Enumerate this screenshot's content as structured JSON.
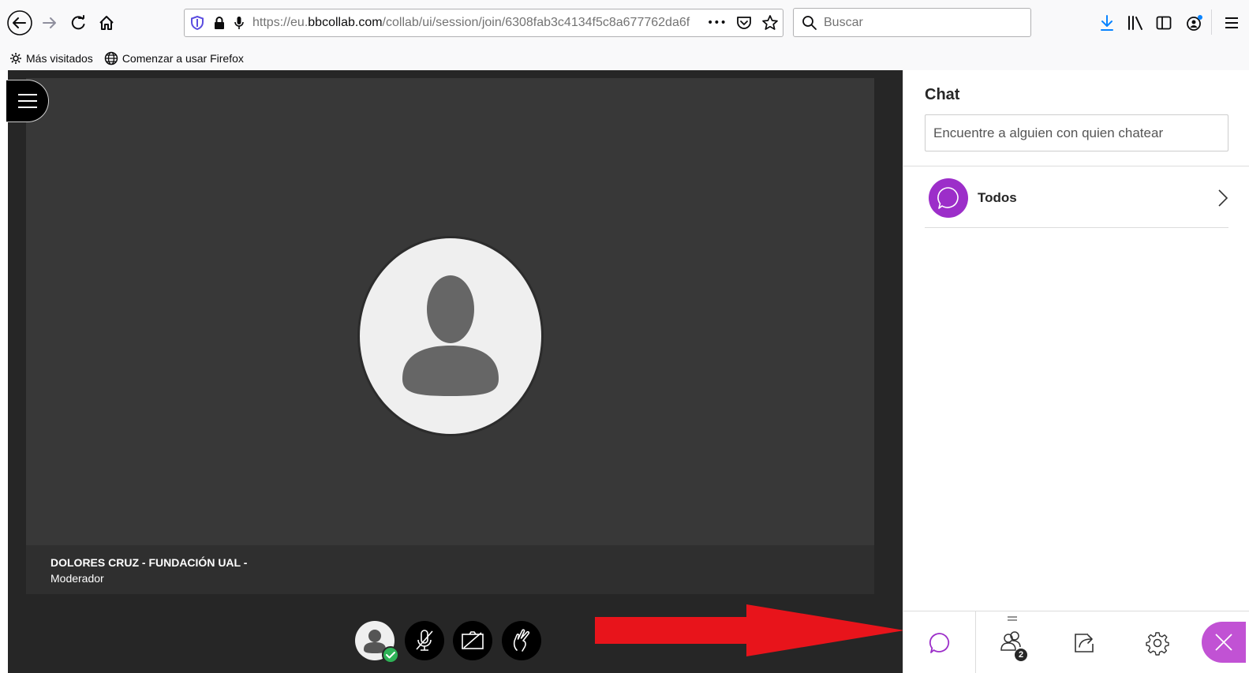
{
  "browser": {
    "url_prefix": "https://eu.",
    "url_domain": "bbcollab.com",
    "url_path": "/collab/ui/session/join/6308fab3c4134f5c8a677762da6f",
    "search_placeholder": "Buscar",
    "more_icon": "•••"
  },
  "bookmarks": [
    {
      "label": "Más visitados",
      "icon": "gear-icon"
    },
    {
      "label": "Comenzar a usar Firefox",
      "icon": "globe-icon"
    }
  ],
  "session": {
    "presenter_name": "DOLORES CRUZ - FUNDACIÓN UAL -",
    "presenter_role": "Moderador"
  },
  "chat": {
    "title": "Chat",
    "search_placeholder": "Encuentre a alguien con quien chatear",
    "channel_label": "Todos",
    "participants_count": "2"
  },
  "colors": {
    "accent": "#9c2ec9",
    "close_accent": "#c152d4",
    "arrow": "#e8141b",
    "stage_bg": "#262626"
  }
}
